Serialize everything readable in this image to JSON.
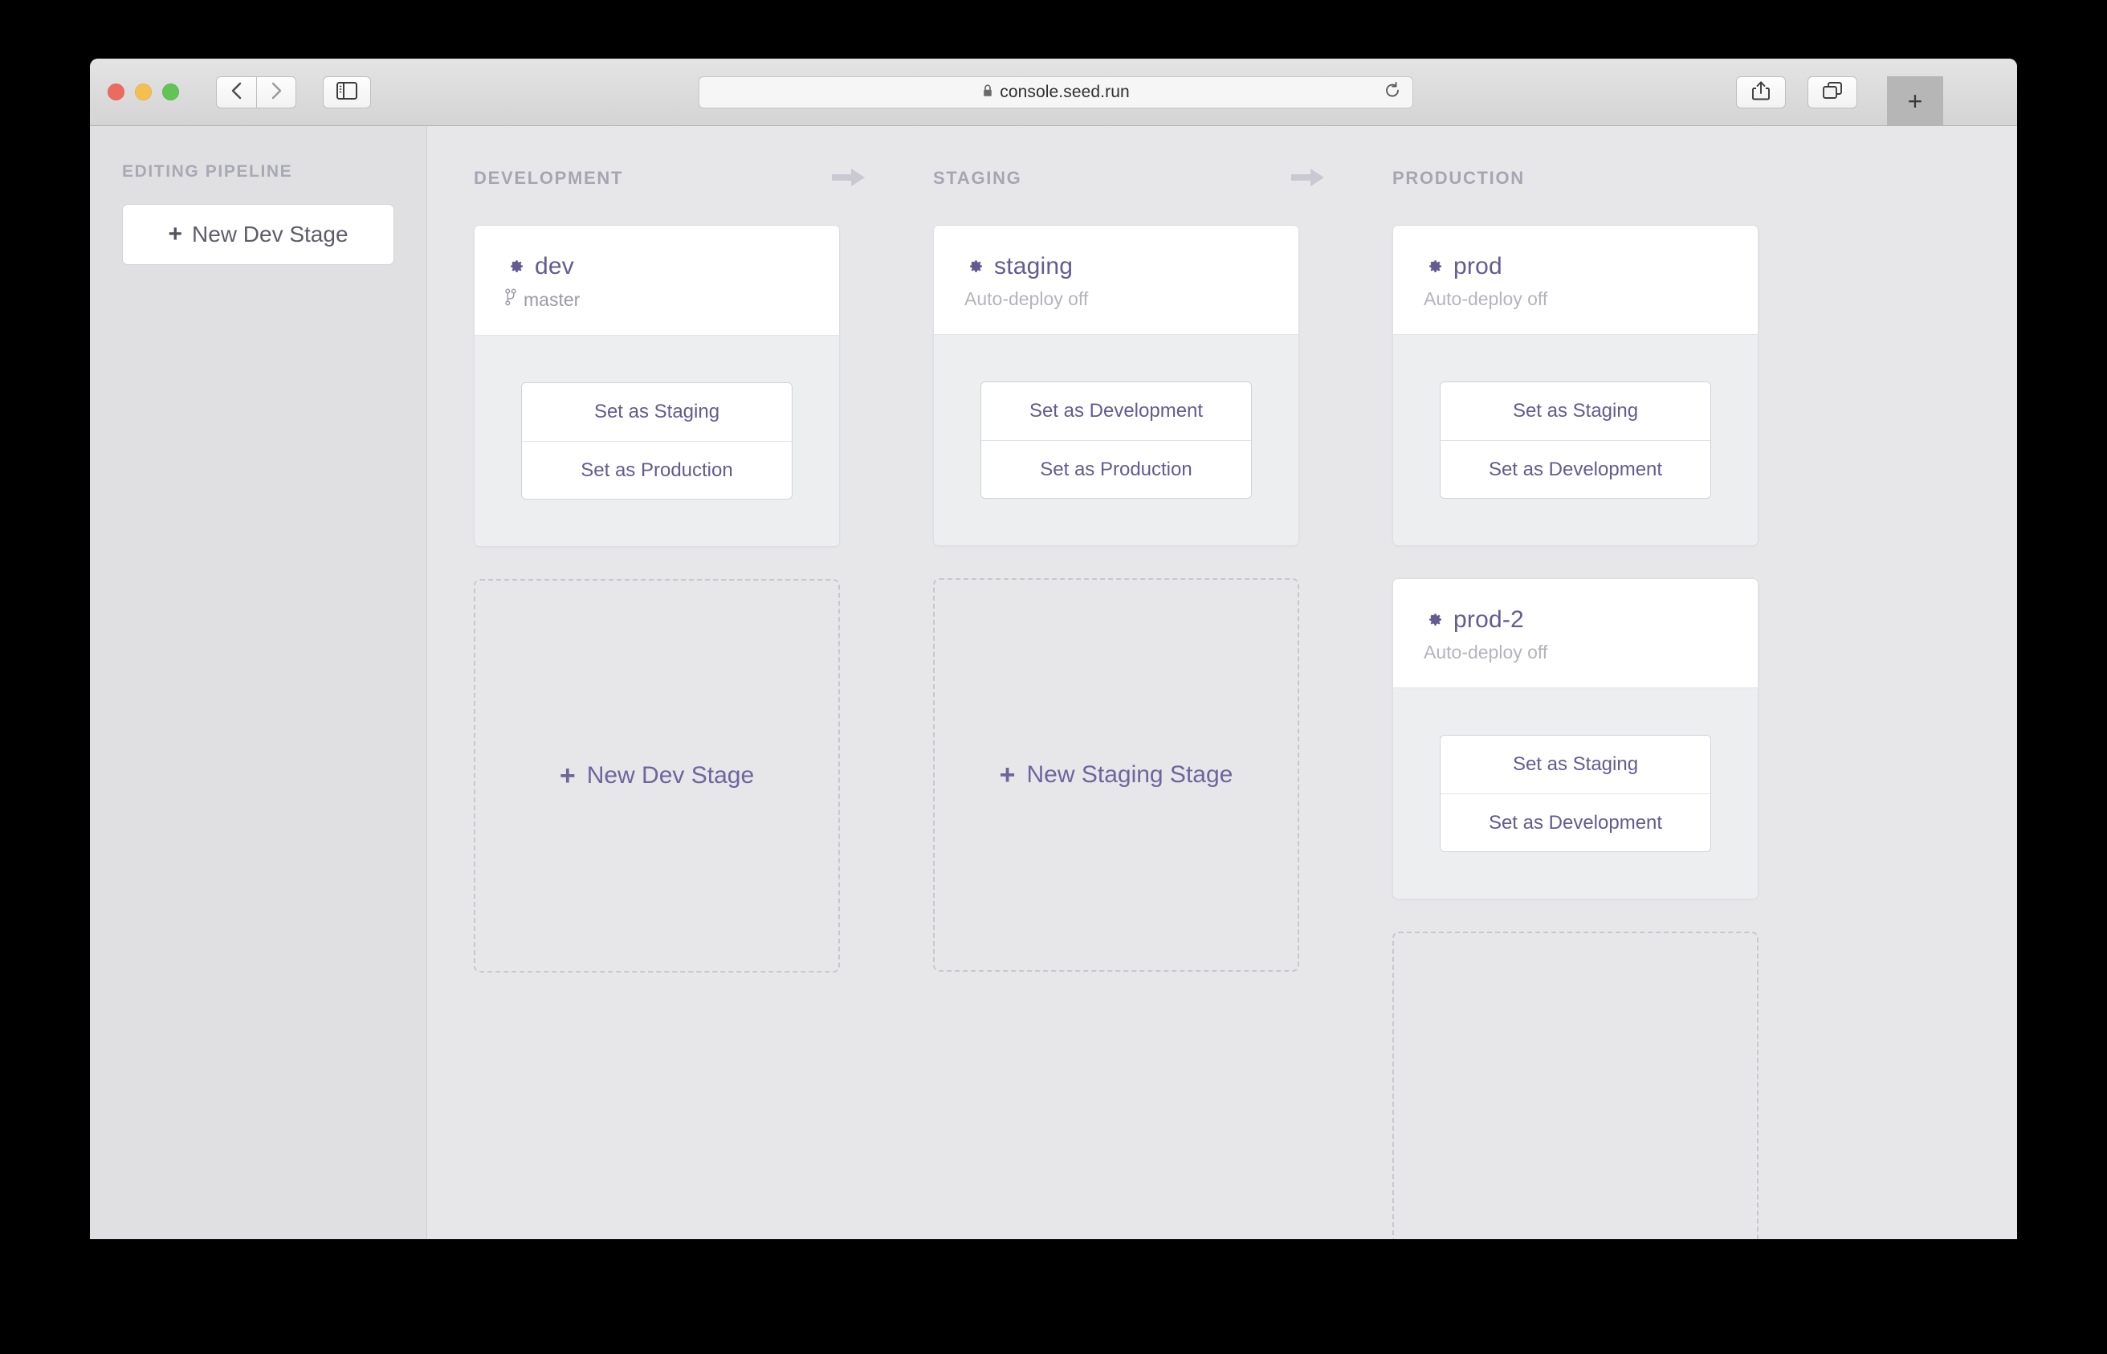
{
  "browser": {
    "url": "console.seed.run",
    "lock_icon": "lock-icon",
    "reload_icon": "reload-icon",
    "back_icon": "chevron-left-icon",
    "forward_icon": "chevron-right-icon",
    "sidebar_icon": "sidebar-panel-icon",
    "share_icon": "share-icon",
    "tabs_icon": "tab-overview-icon",
    "new_tab_label": "+",
    "traffic_lights": [
      "close",
      "minimize",
      "maximize"
    ]
  },
  "sidebar": {
    "section_label": "EDITING PIPELINE",
    "new_dev_stage_button": {
      "plus": "+",
      "label": "New Dev Stage"
    }
  },
  "board": {
    "accent_color": "#635b91",
    "columns": [
      {
        "id": "development",
        "title": "DEVELOPMENT",
        "arrow": "arrow-right-icon",
        "cards": [
          {
            "name": "dev",
            "icon": "gear-icon",
            "subtitle": "master",
            "subtitle_icon": "git-branch-icon",
            "actions": [
              "Set as Staging",
              "Set as Production"
            ]
          }
        ],
        "placeholder": {
          "plus": "+",
          "label": "New Dev Stage"
        }
      },
      {
        "id": "staging",
        "title": "STAGING",
        "arrow": "arrow-right-icon",
        "cards": [
          {
            "name": "staging",
            "icon": "gear-icon",
            "subtitle": "Auto-deploy off",
            "subtitle_icon": "",
            "actions": [
              "Set as Development",
              "Set as Production"
            ]
          }
        ],
        "placeholder": {
          "plus": "+",
          "label": "New Staging Stage"
        }
      },
      {
        "id": "production",
        "title": "PRODUCTION",
        "arrow": "",
        "cards": [
          {
            "name": "prod",
            "icon": "gear-icon",
            "subtitle": "Auto-deploy off",
            "subtitle_icon": "",
            "actions": [
              "Set as Staging",
              "Set as Development"
            ]
          },
          {
            "name": "prod-2",
            "icon": "gear-icon",
            "subtitle": "Auto-deploy off",
            "subtitle_icon": "",
            "actions": [
              "Set as Staging",
              "Set as Development"
            ]
          }
        ],
        "placeholder": {
          "plus": "",
          "label": ""
        }
      }
    ]
  }
}
